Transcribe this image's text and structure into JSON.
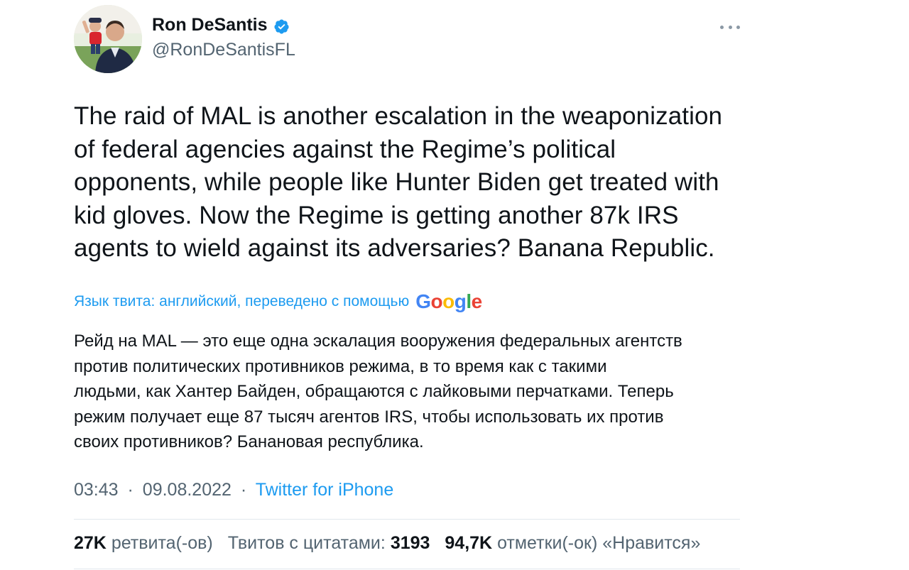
{
  "author": {
    "name": "Ron DeSantis",
    "handle": "@RonDeSantisFL",
    "verified": true,
    "avatar_icon": "profile-photo"
  },
  "tweet": {
    "text": "The raid of MAL is another escalation in the weaponization\nof federal agencies against the Regime’s political\nopponents, while people like Hunter Biden get treated with\nkid gloves. Now the Regime is getting another 87k IRS\nagents to wield against its adversaries? Banana Republic.",
    "translation_label": "Язык твита: английский, переведено с помощью",
    "translation_provider": "Google",
    "translated_text": "Рейд на MAL — это еще одна эскалация вооружения федеральных агентств\nпротив политических противников режима, в то время как с такими\nлюдьми, как Хантер Байден, обращаются с лайковыми перчатками. Теперь\nрежим получает еще 87 тысяч агентов IRS, чтобы использовать их против\nсвоих противников? Банановая республика."
  },
  "meta": {
    "time": "03:43",
    "separator": "·",
    "date": "09.08.2022",
    "source": "Twitter for iPhone"
  },
  "stats": {
    "retweets_count": "27K",
    "retweets_label": "ретвита(-ов)",
    "quotes_label": "Твитов с цитатами:",
    "quotes_count": "3193",
    "likes_count": "94,7K",
    "likes_label": "отметки(-ок) «Нравится»"
  },
  "colors": {
    "link": "#1d9bf0",
    "secondary_text": "#536471",
    "primary_text": "#0f1419",
    "verified_badge": "#1d9bf0"
  }
}
